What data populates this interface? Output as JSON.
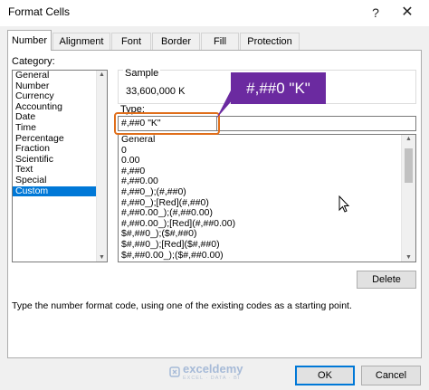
{
  "window": {
    "title": "Format Cells",
    "help_glyph": "?",
    "close_glyph": "✕"
  },
  "tabs": [
    {
      "label": "Number",
      "active": true
    },
    {
      "label": "Alignment",
      "active": false
    },
    {
      "label": "Font",
      "active": false
    },
    {
      "label": "Border",
      "active": false
    },
    {
      "label": "Fill",
      "active": false
    },
    {
      "label": "Protection",
      "active": false
    }
  ],
  "category": {
    "label": "Category:",
    "items": [
      "General",
      "Number",
      "Currency",
      "Accounting",
      "Date",
      "Time",
      "Percentage",
      "Fraction",
      "Scientific",
      "Text",
      "Special",
      "Custom"
    ],
    "selected": "Custom"
  },
  "sample": {
    "label": "Sample",
    "value": "33,600,000 K"
  },
  "type": {
    "label": "Type:",
    "value": "#,##0 \"K\"",
    "formats": [
      "General",
      "0",
      "0.00",
      "#,##0",
      "#,##0.00",
      "#,##0_);(#,##0)",
      "#,##0_);[Red](#,##0)",
      "#,##0.00_);(#,##0.00)",
      "#,##0.00_);[Red](#,##0.00)",
      "$#,##0_);($#,##0)",
      "$#,##0_);[Red]($#,##0)",
      "$#,##0.00_);($#,##0.00)"
    ]
  },
  "callout": {
    "text": "#,##0 \"K\""
  },
  "buttons": {
    "delete": "Delete",
    "ok": "OK",
    "cancel": "Cancel"
  },
  "description": "Type the number format code, using one of the existing codes as a starting point.",
  "watermark": {
    "name": "exceldemy",
    "tagline": "EXCEL · DATA · BI"
  },
  "colors": {
    "selection": "#0078d7",
    "highlight": "#e06e1a",
    "callout": "#6b2aa0"
  }
}
